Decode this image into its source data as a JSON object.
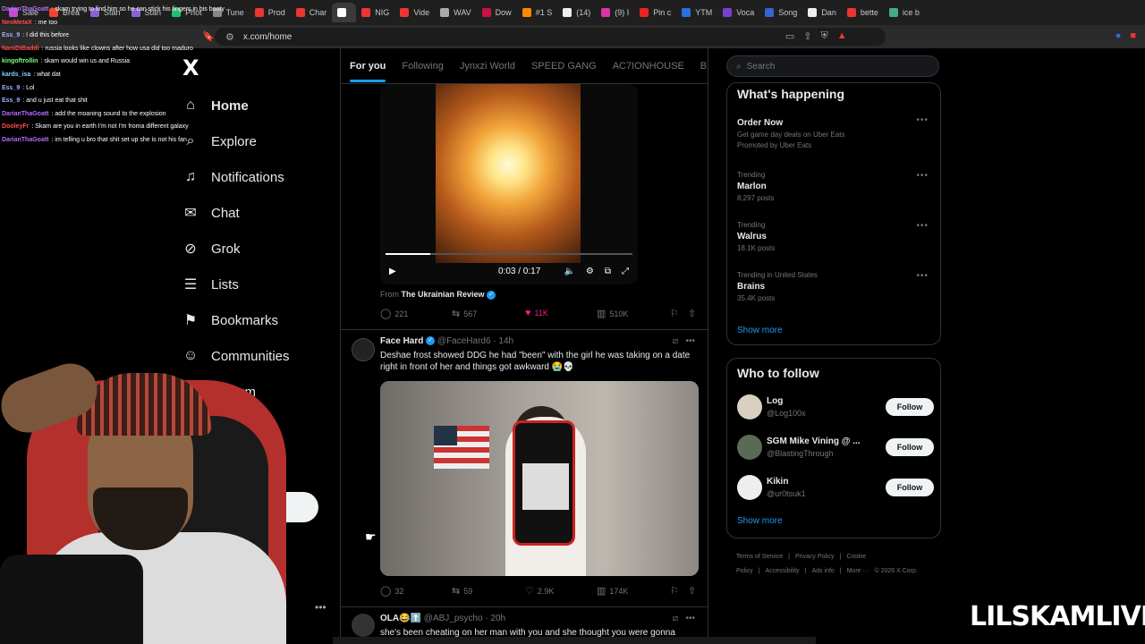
{
  "browser": {
    "tabs": [
      {
        "label": "Sale",
        "color": "#c34bd1"
      },
      {
        "label": "Brea",
        "color": "#e43"
      },
      {
        "label": "Stan",
        "color": "#8a63d2"
      },
      {
        "label": "Stan",
        "color": "#8a63d2"
      },
      {
        "label": "Phot",
        "color": "#2b7"
      },
      {
        "label": "Tune",
        "color": "#888"
      },
      {
        "label": "Prod",
        "color": "#e33"
      },
      {
        "label": "Char",
        "color": "#e33"
      },
      {
        "label": "",
        "color": "#fff"
      },
      {
        "label": "NIG",
        "color": "#e33"
      },
      {
        "label": "Vide",
        "color": "#e33"
      },
      {
        "label": "WAV",
        "color": "#aaa"
      },
      {
        "label": "Dow",
        "color": "#c14"
      },
      {
        "label": "#1 S",
        "color": "#f80"
      },
      {
        "label": "(14)",
        "color": "#eee"
      },
      {
        "label": "(9) I",
        "color": "#d3a"
      },
      {
        "label": "Pin c",
        "color": "#e22"
      },
      {
        "label": "YTM",
        "color": "#2a6fdb"
      },
      {
        "label": "Voca",
        "color": "#7a3fd0"
      },
      {
        "label": "Song",
        "color": "#36c"
      },
      {
        "label": "Dan",
        "color": "#eee"
      },
      {
        "label": "bette",
        "color": "#e33"
      },
      {
        "label": "ice b",
        "color": "#4a8"
      }
    ],
    "url": "x.com/home"
  },
  "chat": [
    {
      "user": "DarianThaGoatt",
      "color": "#b56bff",
      "msg": ": skam trying to find him so he can stick his fingers in his booty"
    },
    {
      "user": "NeoMetaX",
      "color": "#ff4d4d",
      "msg": ": me too"
    },
    {
      "user": "Ess_9",
      "color": "#9db4ff",
      "msg": ": I did this before"
    },
    {
      "user": "NaniDiBaddi",
      "color": "#ff4d4d",
      "msg": ": russia looks like clowns after how usa did too maduro"
    },
    {
      "user": "kingoftrollin",
      "color": "#7dff7d",
      "msg": ": skam would win us and Russia"
    },
    {
      "user": "kards_isa",
      "color": "#7dd3ff",
      "msg": ": what dat"
    },
    {
      "user": "Ess_9",
      "color": "#9db4ff",
      "msg": ": Lol"
    },
    {
      "user": "Ess_9",
      "color": "#9db4ff",
      "msg": ": and u just eat that shit"
    },
    {
      "user": "DarianThaGoatt",
      "color": "#b56bff",
      "msg": ": add the moaning sound to the explosion"
    },
    {
      "user": "DooleyFr",
      "color": "#ff4d4d",
      "msg": ": Skam are you in earth I'm not I'm froma different galaxy"
    },
    {
      "user": "DarianThaGoatt",
      "color": "#b56bff",
      "msg": ": im telling u bro that shit set up she is not his fan"
    }
  ],
  "nav": {
    "logo": "X",
    "items": [
      {
        "label": "Home",
        "icon": "home-icon",
        "glyph": "⌂"
      },
      {
        "label": "Explore",
        "icon": "search-icon",
        "glyph": "⌕"
      },
      {
        "label": "Notifications",
        "icon": "bell-icon",
        "glyph": "♫"
      },
      {
        "label": "Chat",
        "icon": "mail-icon",
        "glyph": "✉"
      },
      {
        "label": "Grok",
        "icon": "grok-icon",
        "glyph": "⊘"
      },
      {
        "label": "Lists",
        "icon": "list-icon",
        "glyph": "☰"
      },
      {
        "label": "Bookmarks",
        "icon": "bookmark-icon",
        "glyph": "⚑"
      },
      {
        "label": "Communities",
        "icon": "communities-icon",
        "glyph": "☺"
      },
      {
        "label": "remium",
        "icon": "premium-icon",
        "glyph": ""
      },
      {
        "label": "e",
        "icon": "profile-icon",
        "glyph": ""
      }
    ],
    "more_dots": "•••"
  },
  "feed": {
    "tabs": [
      "For you",
      "Following",
      "Jynxzi World",
      "SPEED GANG",
      "AC7IONHOUSE",
      "B"
    ],
    "tweet1": {
      "video_time": "0:03 / 0:17",
      "video_progress": 0.18,
      "from_prefix": "From ",
      "from_source": "The Ukrainian Review",
      "replies": "221",
      "reposts": "567",
      "likes": "11K",
      "views": "510K"
    },
    "tweet2": {
      "name": "Face Hard",
      "handle": "@FaceHard6",
      "time": "· 14h",
      "text": "Deshae frost showed DDG he had \"been\" with the girl he was taking on a date right in front of her and things got awkward 😭💀",
      "replies": "32",
      "reposts": "59",
      "likes": "2.9K",
      "views": "174K"
    },
    "tweet3": {
      "name": "OLA😂⬆️",
      "handle": "@ABJ_psycho",
      "time": "· 20h",
      "text": "she's been cheating on her man with you and she thought you were gonna"
    }
  },
  "sidebar": {
    "search_placeholder": "Search",
    "happening_title": "What's happening",
    "trends": [
      {
        "context": "",
        "title": "Order Now",
        "sub": "Get game day deals on Uber Eats",
        "sub2": "Promoted by Uber Eats"
      },
      {
        "context": "Trending",
        "title": "Marlon",
        "sub": "8,297 posts",
        "sub2": ""
      },
      {
        "context": "Trending",
        "title": "Walrus",
        "sub": "18.1K posts",
        "sub2": ""
      },
      {
        "context": "Trending in United States",
        "title": "Brains",
        "sub": "35.4K posts",
        "sub2": ""
      }
    ],
    "show_more": "Show more",
    "who_title": "Who to follow",
    "who": [
      {
        "name": "Log",
        "handle": "@Log100x",
        "color": "#d9d0c2"
      },
      {
        "name": "SGM Mike Vining @ ...",
        "handle": "@BlastingThrough",
        "color": "#5a6b55"
      },
      {
        "name": "Kikin",
        "handle": "@ur0tsuk1",
        "color": "#eee"
      }
    ],
    "follow_label": "Follow",
    "footer": [
      "Terms of Service",
      "|",
      "Privacy Policy",
      "|",
      "Cookie Policy",
      "|",
      "Accessibility",
      "|",
      "Ads info",
      "|",
      "More ···",
      "© 2026 X Corp."
    ]
  },
  "overlay": {
    "watermark": "LILSKAMLIVE"
  }
}
